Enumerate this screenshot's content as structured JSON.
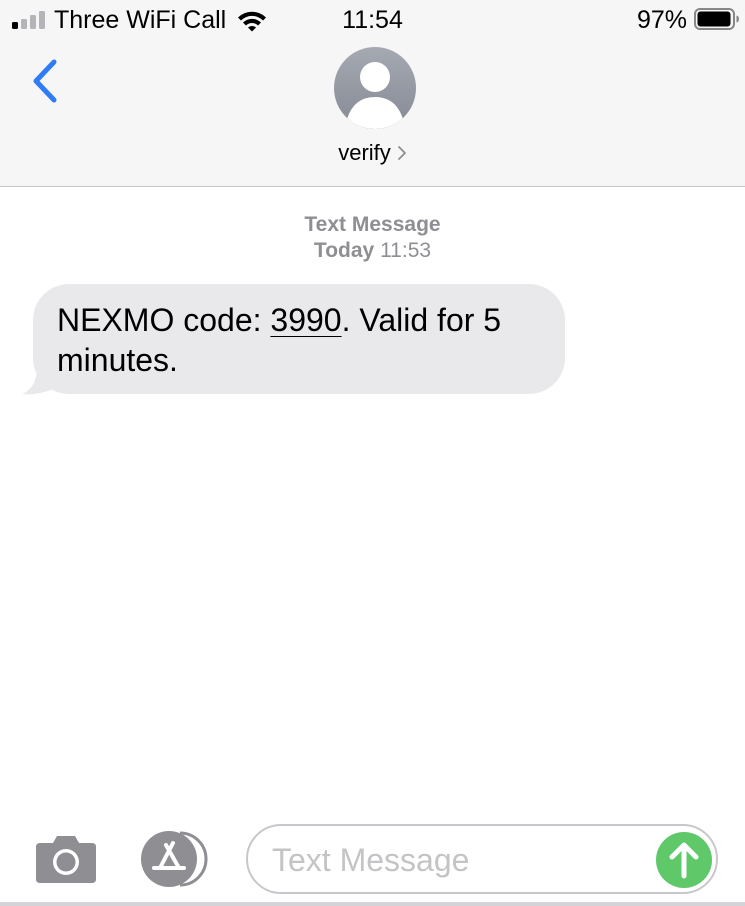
{
  "status_bar": {
    "carrier": "Three WiFi Call",
    "time": "11:54",
    "battery_percent": "97%",
    "battery_level": 0.97,
    "signal_bars_filled": 1,
    "signal_bars_total": 4
  },
  "nav": {
    "contact_name": "verify",
    "accent_color": "#2f7cf6"
  },
  "conversation": {
    "header_title": "Text Message",
    "header_day": "Today",
    "header_time": "11:53",
    "messages": [
      {
        "text_before": "NEXMO code: ",
        "code": "3990",
        "text_after": ". Valid for 5 minutes."
      }
    ]
  },
  "input_bar": {
    "placeholder": "Text Message",
    "value": "",
    "send_color": "#5fc96a"
  },
  "icons": {
    "back": "chevron-left-icon",
    "avatar": "person-icon",
    "camera": "camera-icon",
    "app_store": "app-store-icon",
    "send": "arrow-up-icon"
  }
}
